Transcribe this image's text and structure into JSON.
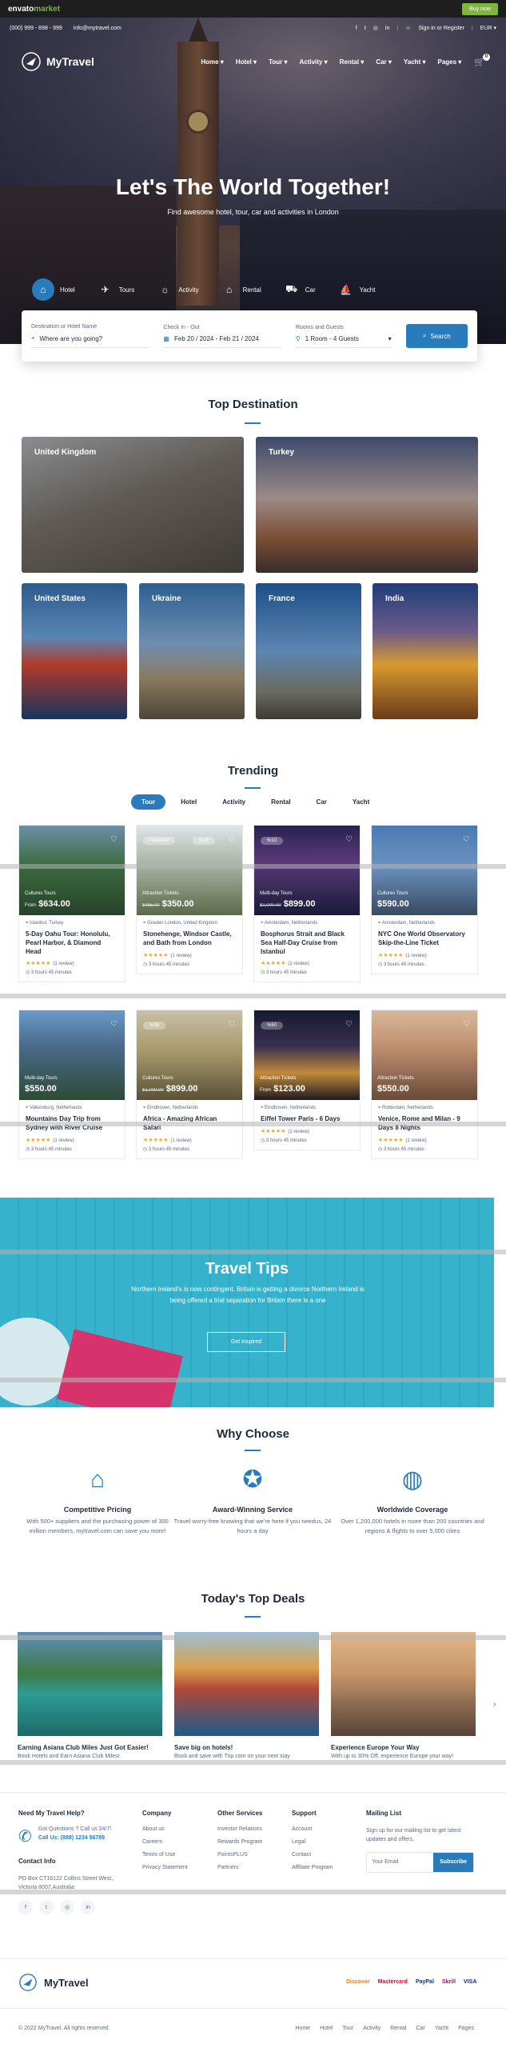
{
  "envato": {
    "logo_a": "envato",
    "logo_b": "market",
    "buy": "Buy now"
  },
  "topbar": {
    "phone": "(000) 999 - 898 - 999",
    "email": "info@mytravel.com",
    "signin": "Sign in or Register",
    "currency": "EUR"
  },
  "nav": {
    "brand": "MyTravel",
    "items": [
      "Home",
      "Hotel",
      "Tour",
      "Activity",
      "Rental",
      "Car",
      "Yacht",
      "Pages"
    ],
    "cart_count": "0"
  },
  "hero": {
    "title": "Let's The World Together!",
    "subtitle": "Find awesome hotel, tour, car and activities in London"
  },
  "tabs": [
    {
      "label": "Hotel",
      "icon": "hotel-icon"
    },
    {
      "label": "Tours",
      "icon": "tours-icon"
    },
    {
      "label": "Activity",
      "icon": "activity-icon"
    },
    {
      "label": "Rental",
      "icon": "rental-icon"
    },
    {
      "label": "Car",
      "icon": "car-icon"
    },
    {
      "label": "Yacht",
      "icon": "yacht-icon"
    }
  ],
  "search": {
    "dest_label": "Destination or Hotel Name",
    "dest_placeholder": "Where are you going?",
    "date_label": "Check In - Out",
    "date_value": "Feb 20 / 2024 - Feb 21 / 2024",
    "rooms_label": "Rooms and Guests",
    "rooms_value": "1 Room - 4 Guests",
    "button": "Search"
  },
  "top_destination": {
    "title": "Top Destination",
    "items": [
      "United Kingdom",
      "Turkey",
      "United States",
      "Ukraine",
      "France",
      "India"
    ]
  },
  "trending": {
    "title": "Trending",
    "tabs": [
      "Tour",
      "Hotel",
      "Activity",
      "Rental",
      "Car",
      "Yacht"
    ],
    "cards": [
      {
        "category": "Cultures Tours",
        "from": "From",
        "price": "$634.00",
        "old": "",
        "badge": "",
        "location": "Istanbul, Turkey",
        "title": "5-Day Oahu Tour: Honolulu, Pearl Harbor, & Diamond Head",
        "reviews": "(1 review)",
        "duration": "3 hours 45 minutes"
      },
      {
        "category": "Attraction Tickets",
        "from": "",
        "price": "$350.00",
        "old": "$465.00",
        "badge": "Featured",
        "badge2": "%25",
        "location": "Greater London, United Kingdom",
        "title": "Stonehenge, Windsor Castle, and Bath from London",
        "reviews": "(1 review)",
        "duration": "3 hours 45 minutes"
      },
      {
        "category": "Multi-day Tours",
        "from": "",
        "price": "$899.00",
        "old": "$1,000.00",
        "badge": "%10",
        "location": "Amsterdam, Netherlands",
        "title": "Bosphorus Strait and Black Sea Half-Day Cruise from Istanbul",
        "reviews": "(1 review)",
        "duration": "3 hours 45 minutes"
      },
      {
        "category": "Cultures Tours",
        "from": "",
        "price": "$590.00",
        "old": "",
        "badge": "",
        "location": "Amsterdam, Netherlands",
        "title": "NYC One World Observatory Skip-the-Line Ticket",
        "reviews": "(1 review)",
        "duration": "3 hours 45 minutes"
      },
      {
        "category": "Multi-day Tours",
        "from": "",
        "price": "$550.00",
        "old": "",
        "badge": "",
        "location": "Valkenburg, Netherlands",
        "title": "Mountains Day Trip from Sydney with River Cruise",
        "reviews": "(1 review)",
        "duration": "3 hours 45 minutes"
      },
      {
        "category": "Cultures Tours",
        "from": "",
        "price": "$899.00",
        "old": "$1,000.00",
        "badge": "%36",
        "location": "Eindhoven, Netherlands",
        "title": "Africa - Amazing African Safari",
        "reviews": "(1 review)",
        "duration": "3 hours 45 minutes"
      },
      {
        "category": "Attraction Tickets",
        "from": "From",
        "price": "$123.00",
        "old": "",
        "badge": "%50",
        "location": "Eindhoven, Netherlands",
        "title": "Eiffel Tower Paris - 6 Days",
        "reviews": "(1 review)",
        "duration": "3 hours 45 minutes"
      },
      {
        "category": "Attraction Tickets",
        "from": "",
        "price": "$550.00",
        "old": "",
        "badge": "",
        "location": "Rotterdam, Netherlands",
        "title": "Venice, Rome and Milan - 9 Days 8 Nights",
        "reviews": "(1 review)",
        "duration": "3 hours 45 minutes"
      }
    ]
  },
  "tips": {
    "title": "Travel Tips",
    "text": "Northern Ireland's is now contingent. Britain is getting a divorce Northern Ireland is being offered a trial separation for Britain there is a one",
    "button": "Get Inspired"
  },
  "why": {
    "title": "Why Choose",
    "items": [
      {
        "icon": "tag-icon",
        "title": "Competitive Pricing",
        "text": "With 500+ suppliers and the purchasing power of 300 million members, mytravel.com can save you more!"
      },
      {
        "icon": "award-icon",
        "title": "Award-Winning Service",
        "text": "Travel worry-free knowing that we're here if you needus, 24 hours a day"
      },
      {
        "icon": "globe-icon",
        "title": "Worldwide Coverage",
        "text": "Over 1,200,000 hotels in more than 200 countries and regions & flights to over 5,000 cities"
      }
    ]
  },
  "deals": {
    "title": "Today's Top Deals",
    "items": [
      {
        "title": "Earning Asiana Club Miles Just Got Easier!",
        "text": "Book Hotels and Earn Asiana Club Miles!"
      },
      {
        "title": "Save big on hotels!",
        "text": "Book and save with Trip.com on your next stay"
      },
      {
        "title": "Experience Europe Your Way",
        "text": "With up to 30% Off, experience Europe your way!"
      }
    ]
  },
  "footer": {
    "help_title": "Need My Travel Help?",
    "help_text": "Got Questions ? Call us 24/7!",
    "call_label": "Call Us:",
    "call_number": "(888) 1234 56789",
    "contact_title": "Contact Info",
    "contact_text": "PO Box CT16122 Collins Street West, Victoria 8007,Australia",
    "company_title": "Company",
    "company": [
      "About us",
      "Careers",
      "Terms of Use",
      "Privacy Statement"
    ],
    "services_title": "Other Services",
    "services": [
      "Investor Relations",
      "Rewards Program",
      "PointsPLUS",
      "Partners"
    ],
    "support_title": "Support",
    "support": [
      "Account",
      "Legal",
      "Contact",
      "Affiliate Program"
    ],
    "mailing_title": "Mailing List",
    "mailing_text": "Sign up for our mailing list to get latest updates and offers.",
    "email_placeholder": "Your Email",
    "subscribe": "Subscribe",
    "brand": "MyTravel",
    "payments": [
      "Discover",
      "Mastercard",
      "PayPal",
      "Skrill",
      "VISA"
    ],
    "copyright": "© 2022 MyTravel. All rights reserved",
    "links": [
      "Home",
      "Hotel",
      "Tour",
      "Activity",
      "Rental",
      "Car",
      "Yacht",
      "Pages"
    ]
  },
  "colors": {
    "accent": "#297cbb",
    "dark": "#1e2a3a",
    "star": "#f5a623",
    "tips_bg": "#37b2cc"
  }
}
